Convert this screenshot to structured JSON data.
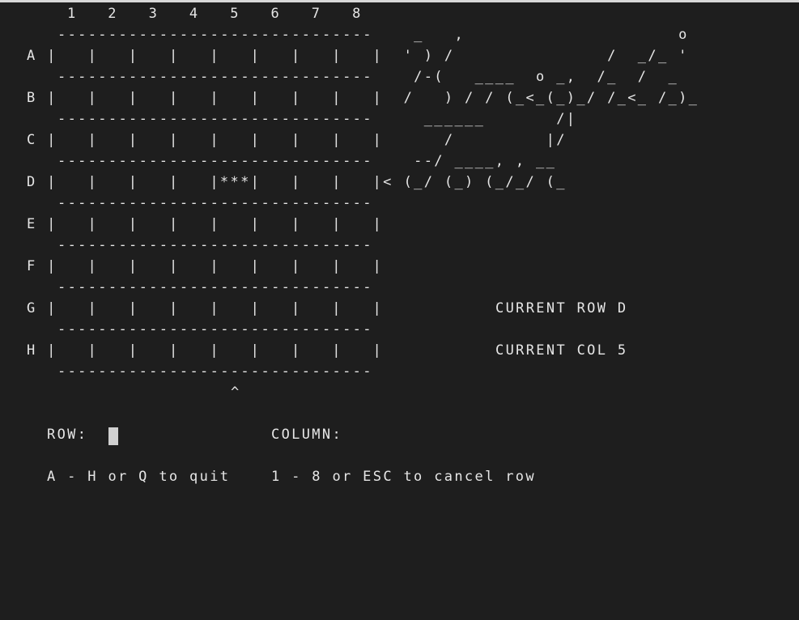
{
  "board": {
    "column_header": "1   2   3   4   5   6   7   8",
    "separator": "-------------------------------",
    "rows": [
      "A |   |   |   |   |   |   |   |   |",
      "B |   |   |   |   |   |   |   |   |",
      "C |   |   |   |   |   |   |   |   |",
      "D |   |   |   |   |***|   |   |   |<",
      "E |   |   |   |   |   |   |   |   |",
      "F |   |   |   |   |   |   |   |   |",
      "G |   |   |   |   |   |   |   |   |",
      "H |   |   |   |   |   |   |   |   |"
    ],
    "column_marker": "^"
  },
  "banner_art": [
    "  _   ,                     o",
    " ' ) /               /  _/_ '",
    "  /-(   ____  o _,  /_  /  _",
    " /   ) / / (_<_(_)_/ /_<_ /_)_",
    "   ______       /|",
    "     /         |/",
    "  --/ ____, , __",
    " (_/ (_) (_/_/ (_"
  ],
  "status": {
    "current_row": "CURRENT ROW D",
    "current_col": "CURRENT COL 5"
  },
  "prompt": {
    "row_label": "ROW:",
    "row_value": "",
    "column_label": "COLUMN:",
    "row_help": "A - H or Q to quit",
    "column_help": "1 - 8 or ESC to cancel row"
  }
}
